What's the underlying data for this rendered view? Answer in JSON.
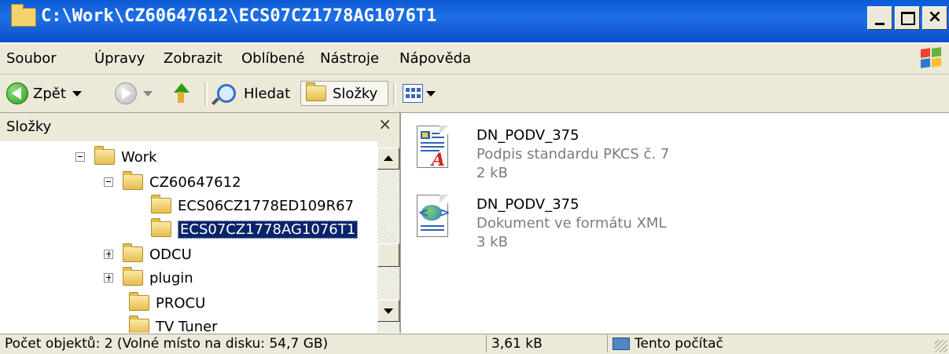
{
  "window": {
    "title": "C:\\Work\\CZ60647612\\ECS07CZ1778AG1076T1"
  },
  "menu": [
    "Soubor",
    "Úpravy",
    "Zobrazit",
    "Oblíbené",
    "Nástroje",
    "Nápověda"
  ],
  "toolbar": {
    "back": "Zpět",
    "search": "Hledat",
    "folders": "Složky"
  },
  "folders_pane": {
    "title": "Složky",
    "close": "×",
    "tree": [
      {
        "label": "Work",
        "expander": "minus"
      },
      {
        "label": "CZ60647612",
        "expander": "minus"
      },
      {
        "label": "ECS06CZ1778ED109R67",
        "expander": "none"
      },
      {
        "label": "ECS07CZ1778AG1076T1",
        "expander": "none",
        "selected": true
      },
      {
        "label": "ODCU",
        "expander": "plus"
      },
      {
        "label": "plugin",
        "expander": "plus"
      },
      {
        "label": "PROCU",
        "expander": "none"
      },
      {
        "label": "TV Tuner",
        "expander": "none"
      }
    ]
  },
  "files": [
    {
      "name": "DN_PODV_375",
      "type": "Podpis standardu PKCS č. 7",
      "size": "2 kB",
      "icon": "pkcs-signature-icon"
    },
    {
      "name": "DN_PODV_375",
      "type": "Dokument ve formátu XML",
      "size": "3 kB",
      "icon": "xml-document-icon"
    }
  ],
  "status": {
    "objects": "Počet objektů: 2 (Volné místo na disku: 54,7 GB)",
    "size": "3,61 kB",
    "location": "Tento počítač"
  },
  "colors": {
    "titlebar": "#0a5ad6",
    "selection": "#0a246a",
    "chrome": "#ece9d8"
  }
}
